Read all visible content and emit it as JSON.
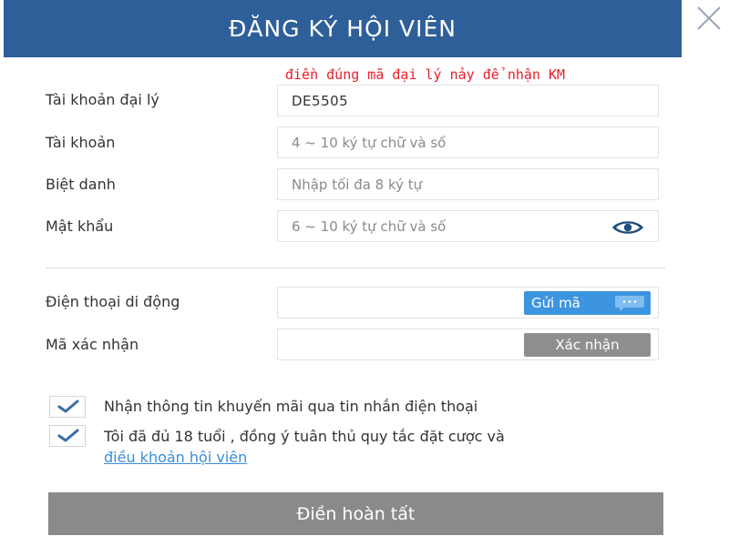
{
  "header": {
    "title": "ĐĂNG KÝ HỘI VIÊN"
  },
  "promo_note": "điền đúng mã đại lý nảy để nhận KM",
  "form": {
    "agent_account": {
      "label": "Tài khoản đại lý",
      "value": "DE5505"
    },
    "account": {
      "label": "Tài khoản",
      "placeholder": "4 ~ 10 ký tự chữ và số"
    },
    "nickname": {
      "label": "Biệt danh",
      "placeholder": "Nhập tối đa 8 ký tự"
    },
    "password": {
      "label": "Mật khẩu",
      "placeholder": "6 ~ 10 ký tự chữ và số"
    },
    "phone": {
      "label": "Điện thoại di động",
      "value": "",
      "send_code_label": "Gửi mã"
    },
    "verification": {
      "label": "Mã xác nhận",
      "value": "",
      "verify_label": "Xác nhận"
    }
  },
  "checks": {
    "promo_sms": {
      "checked": true,
      "text": "Nhận thông tin khuyến mãi qua tin nhắn điện thoại"
    },
    "age_terms": {
      "checked": true,
      "text": "Tôi đã đủ 18 tuổi , đồng ý tuân thủ quy tắc đặt cược và",
      "link": "điều khoản hội viên"
    }
  },
  "submit_label": "Điền hoàn tất",
  "colors": {
    "header_bg": "#2f5f99",
    "send_button": "#3d94df",
    "disabled_button": "#8f8f8f",
    "promo_text": "#e8202a",
    "link": "#3a8ed8"
  }
}
